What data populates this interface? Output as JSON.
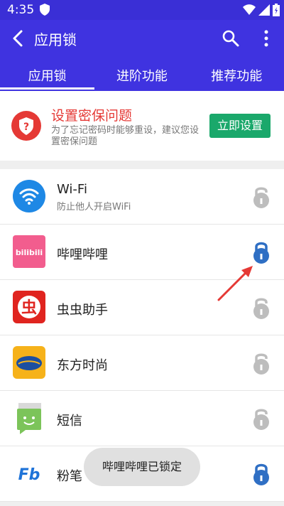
{
  "status": {
    "time": "4:35"
  },
  "appbar": {
    "title": "应用锁"
  },
  "tabs": [
    {
      "label": "应用锁"
    },
    {
      "label": "进阶功能"
    },
    {
      "label": "推荐功能"
    }
  ],
  "promo": {
    "title": "设置密保问题",
    "desc": "为了忘记密码时能够重设，建议您设置密保问题",
    "button": "立即设置"
  },
  "apps": [
    {
      "name": "Wi-Fi",
      "sub": "防止他人开启WiFi",
      "locked": false
    },
    {
      "name": "哔哩哔哩",
      "sub": "",
      "locked": true
    },
    {
      "name": "虫虫助手",
      "sub": "",
      "locked": false
    },
    {
      "name": "东方时尚",
      "sub": "",
      "locked": false
    },
    {
      "name": "短信",
      "sub": "",
      "locked": false
    },
    {
      "name": "粉笔",
      "sub": "",
      "locked": true
    }
  ],
  "toast": "哔哩哔哩已锁定",
  "colors": {
    "primary": "#3f33e0",
    "locked": "#2f6fc4",
    "unlocked": "#bdbdbd",
    "promo_title": "#e53935",
    "button": "#1aa86b"
  }
}
